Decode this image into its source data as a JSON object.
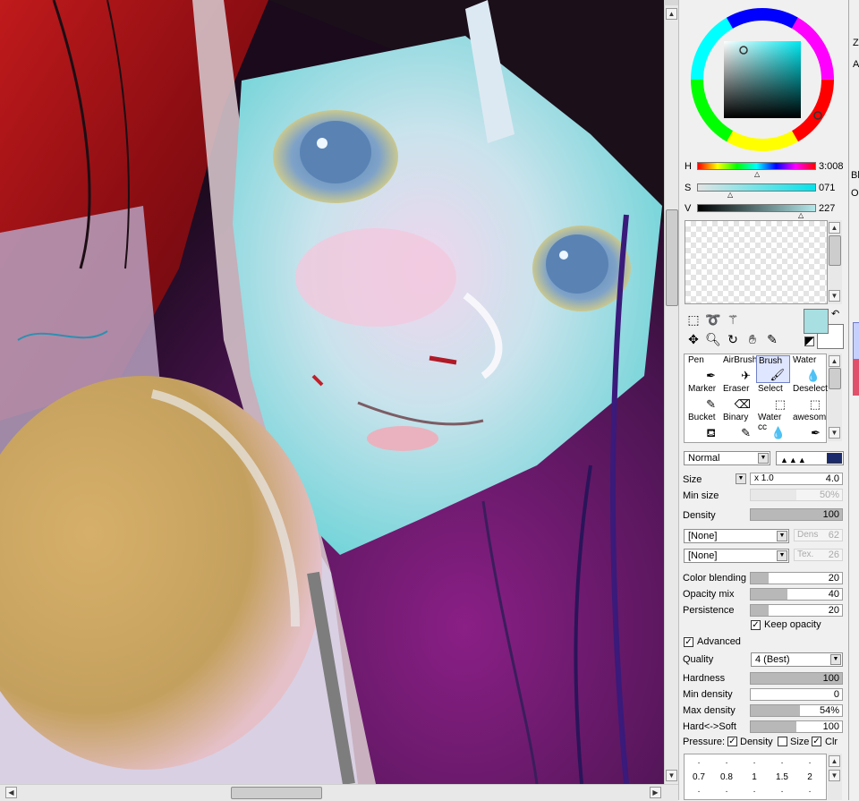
{
  "color": {
    "h_label": "H",
    "s_label": "S",
    "v_label": "V",
    "h_value": "3:008",
    "s_value": "071",
    "v_value": "227",
    "h": 0.5,
    "s": 0.28,
    "v": 0.89,
    "foreground": "#a8dfe2",
    "background": "#ffffff"
  },
  "tools": [
    {
      "label": "Pen",
      "icon": "pen-icon"
    },
    {
      "label": "AirBrush",
      "icon": "airbrush-icon"
    },
    {
      "label": "Brush",
      "icon": "brush-icon"
    },
    {
      "label": "Water",
      "icon": "water-icon"
    },
    {
      "label": "Marker",
      "icon": "marker-icon"
    },
    {
      "label": "Eraser",
      "icon": "eraser-icon"
    },
    {
      "label": "Select",
      "icon": "select-icon"
    },
    {
      "label": "Deselect",
      "icon": "deselect-icon"
    },
    {
      "label": "Bucket",
      "icon": "bucket-icon"
    },
    {
      "label": "Binary",
      "icon": "binary-icon"
    },
    {
      "label": "Water cc",
      "icon": "water-cc-icon"
    },
    {
      "label": "awesom",
      "icon": "awesome-icon"
    }
  ],
  "selected_tool": "Brush",
  "blend_mode": "Normal",
  "size": {
    "label": "Size",
    "multiplier": "x 1.0",
    "value": "4.0"
  },
  "min_size": {
    "label": "Min size",
    "value": "50%",
    "level": 0.5
  },
  "density": {
    "label": "Density",
    "value": "100",
    "level": 1.0
  },
  "texture1": {
    "value": "[None]",
    "side_label": "Dens",
    "side_value": "62"
  },
  "texture2": {
    "value": "[None]",
    "side_label": "Tex.",
    "side_value": "26"
  },
  "color_blending": {
    "label": "Color blending",
    "value": "20",
    "level": 0.2
  },
  "opacity_mix": {
    "label": "Opacity mix",
    "value": "40",
    "level": 0.4
  },
  "persistence": {
    "label": "Persistence",
    "value": "20",
    "level": 0.2
  },
  "keep_opacity": {
    "label": "Keep opacity",
    "checked": true
  },
  "advanced": {
    "label": "Advanced",
    "checked": true
  },
  "quality": {
    "label": "Quality",
    "value": "4 (Best)"
  },
  "hardness": {
    "label": "Hardness",
    "value": "100",
    "level": 1.0
  },
  "min_density": {
    "label": "Min density",
    "value": "0",
    "level": 0.0
  },
  "max_density": {
    "label": "Max density",
    "value": "54%",
    "level": 0.54
  },
  "hard_soft": {
    "label": "Hard<->Soft",
    "value": "100",
    "level": 0.5
  },
  "pressure": {
    "label": "Pressure:",
    "density": "Density",
    "size": "Size",
    "clr": "Clr"
  },
  "brush_sizes": [
    "0.7",
    "0.8",
    "1",
    "1.5",
    "2"
  ],
  "right_edge": {
    "z": "Z",
    "a": "A",
    "bl": "Bl",
    "o": "O"
  }
}
